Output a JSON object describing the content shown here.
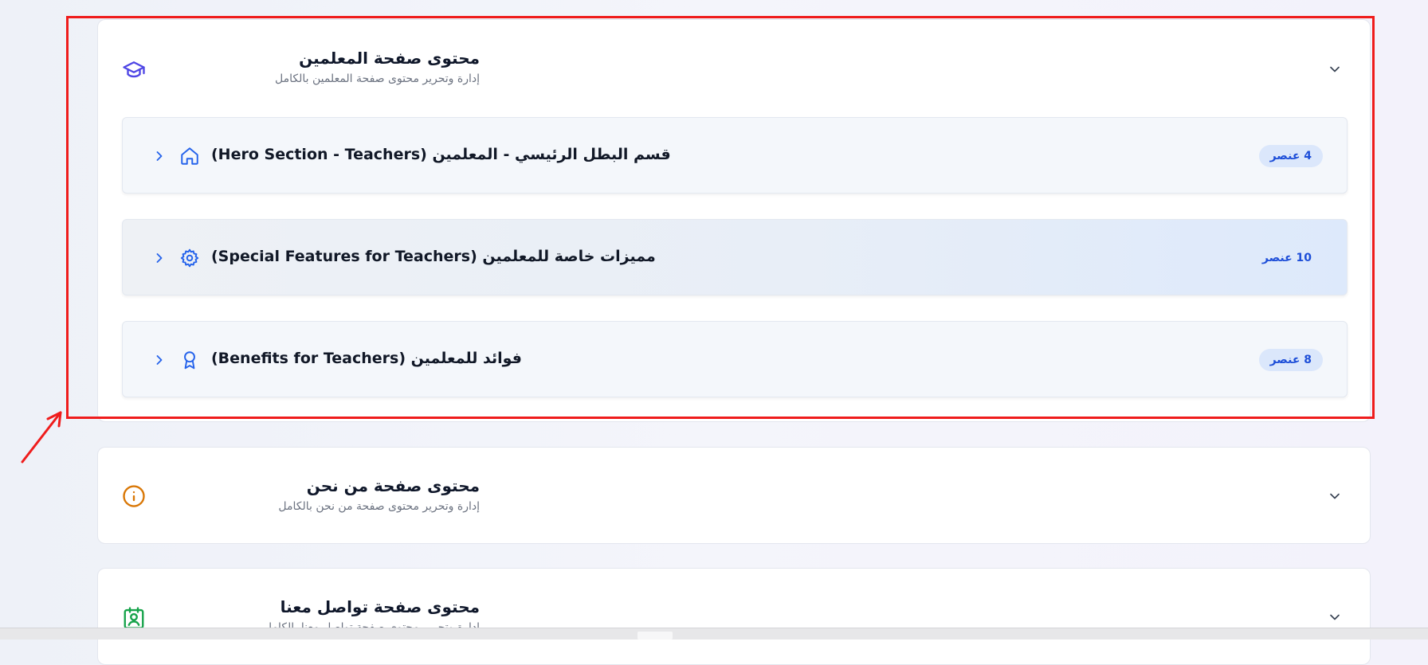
{
  "cards": [
    {
      "title": "محتوى صفحة المعلمين",
      "subtitle": "إدارة وتحرير محتوى صفحة المعلمين بالكامل",
      "icon": "graduation-cap-icon",
      "icon_color": "#4f46e5",
      "sections": [
        {
          "title": "(Hero Section - Teachers) قسم البطل الرئيسي - المعلمين",
          "icon": "home-icon",
          "badge": "4 عنصر"
        },
        {
          "title": "(Special Features for Teachers) مميزات خاصة للمعلمين",
          "icon": "gear-icon",
          "badge": "10 عنصر"
        },
        {
          "title": "(Benefits for Teachers) فوائد للمعلمين",
          "icon": "award-icon",
          "badge": "8 عنصر"
        }
      ]
    },
    {
      "title": "محتوى صفحة من نحن",
      "subtitle": "إدارة وتحرير محتوى صفحة من نحن بالكامل",
      "icon": "info-icon",
      "icon_color": "#d97706"
    },
    {
      "title": "محتوى صفحة تواصل معنا",
      "subtitle": "إدارة وتحرير محتوى صفحة تواصل معنا بالكامل",
      "icon": "contact-card-icon",
      "icon_color": "#16a34a"
    }
  ],
  "colors": {
    "accent": "#2563eb",
    "badge_bg": "#dbe7fb",
    "badge_text": "#1d4ed8",
    "annotation": "#ef1c1c"
  }
}
